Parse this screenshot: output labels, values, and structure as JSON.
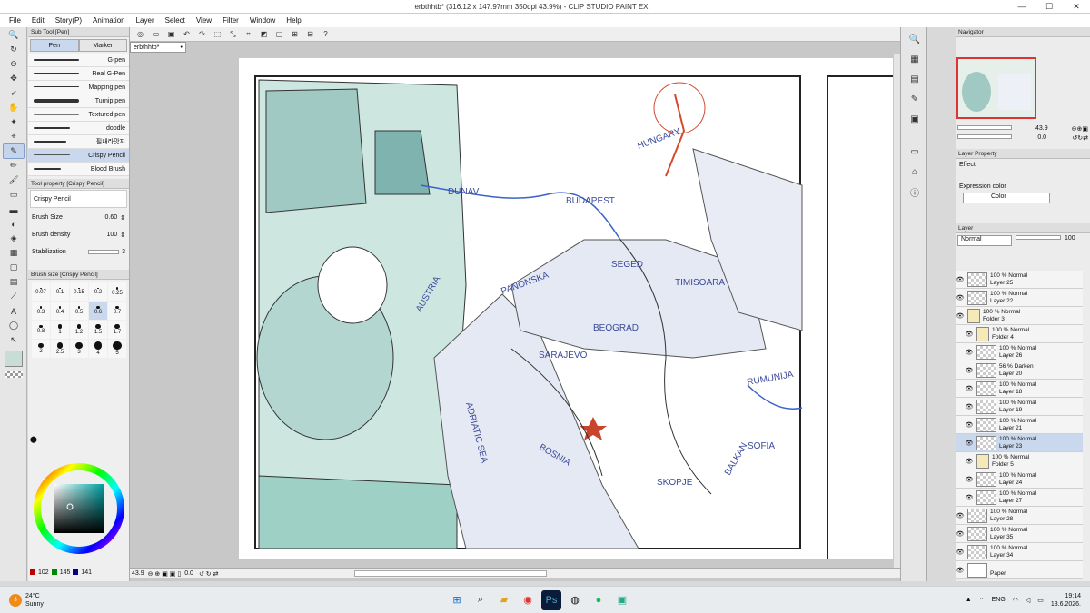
{
  "window": {
    "title": "erbthhtb* (316.12 x 147.97mm 350dpi 43.9%) - CLIP STUDIO PAINT EX",
    "minimize": "—",
    "maximize": "☐",
    "close": "✕"
  },
  "menu": [
    "File",
    "Edit",
    "Story(P)",
    "Animation",
    "Layer",
    "Select",
    "View",
    "Filter",
    "Window",
    "Help"
  ],
  "subtool": {
    "header": "Sub Tool [Pen]",
    "tabs": [
      "Pen",
      "Marker"
    ],
    "brushes": [
      "G-pen",
      "Real G-Pen",
      "Mapping pen",
      "Turnip pen",
      "Textured pen",
      "doodle",
      "필내라맛지",
      "Crispy Pencil",
      "Blood Brush"
    ],
    "active_brush": "Crispy Pencil"
  },
  "tool_property": {
    "header": "Tool property [Crispy Pencil]",
    "name": "Crispy Pencil",
    "brush_size_label": "Brush Size",
    "brush_size": "0.60",
    "brush_density_label": "Brush density",
    "brush_density": "100",
    "stabilization_label": "Stabilization",
    "stabilization": "3"
  },
  "brush_size_panel": {
    "header": "Brush size [Crispy Pencil]",
    "sizes": [
      "0.07",
      "0.1",
      "0.15",
      "0.2",
      "0.25",
      "0.3",
      "0.4",
      "0.5",
      "0.6",
      "0.7",
      "0.8",
      "1",
      "1.2",
      "1.5",
      "1.7",
      "2",
      "2.5",
      "3",
      "4",
      "5"
    ],
    "active": "0.6"
  },
  "color": {
    "r": "102",
    "g": "145",
    "b": "141",
    "main": "#66918d"
  },
  "canvas": {
    "doc_tab": "erbthhtb*",
    "zoom": "43.9",
    "rotation": "0.0",
    "map_labels": [
      "DUNAV",
      "PANONSKA",
      "AUSTRIA",
      "ADRIATIC SEA",
      "SARAJEVO",
      "SOFIA",
      "HUNGARY",
      "RUMUNIJA",
      "TIMISOARA",
      "BALKAN",
      "BEOGRAD",
      "SEGED",
      "BUDAPEST",
      "SKOPJE",
      "BOSNIA"
    ]
  },
  "navigator": {
    "header": "Navigator",
    "zoom": "43.9",
    "angle": "0.0"
  },
  "layer_property": {
    "header": "Layer Property",
    "effect": "Effect",
    "expression_color": "Expression color",
    "color_mode": "Color"
  },
  "layer_panel": {
    "header": "Layer",
    "blend": "Normal",
    "opacity": "100",
    "layers": [
      {
        "mode": "100 % Normal",
        "name": "Layer 25",
        "indent": 0,
        "type": "layer"
      },
      {
        "mode": "100 % Normal",
        "name": "Layer 22",
        "indent": 0,
        "type": "layer"
      },
      {
        "mode": "100 % Normal",
        "name": "Folder 3",
        "indent": 0,
        "type": "folder"
      },
      {
        "mode": "100 % Normal",
        "name": "Folder 4",
        "indent": 1,
        "type": "folder"
      },
      {
        "mode": "100 % Normal",
        "name": "Layer 26",
        "indent": 1,
        "type": "layer"
      },
      {
        "mode": "56 % Darken",
        "name": "Layer 20",
        "indent": 1,
        "type": "layer"
      },
      {
        "mode": "100 % Normal",
        "name": "Layer 18",
        "indent": 1,
        "type": "layer"
      },
      {
        "mode": "100 % Normal",
        "name": "Layer 19",
        "indent": 1,
        "type": "layer"
      },
      {
        "mode": "100 % Normal",
        "name": "Layer 21",
        "indent": 1,
        "type": "layer"
      },
      {
        "mode": "100 % Normal",
        "name": "Layer 23",
        "indent": 1,
        "type": "layer",
        "active": true
      },
      {
        "mode": "100 % Normal",
        "name": "Folder 5",
        "indent": 1,
        "type": "folder"
      },
      {
        "mode": "100 % Normal",
        "name": "Layer 24",
        "indent": 1,
        "type": "layer"
      },
      {
        "mode": "100 % Normal",
        "name": "Layer 27",
        "indent": 1,
        "type": "layer"
      },
      {
        "mode": "100 % Normal",
        "name": "Layer 28",
        "indent": 0,
        "type": "layer"
      },
      {
        "mode": "100 % Normal",
        "name": "Layer 35",
        "indent": 0,
        "type": "layer"
      },
      {
        "mode": "100 % Normal",
        "name": "Layer 34",
        "indent": 0,
        "type": "layer"
      },
      {
        "mode": "",
        "name": "Paper",
        "indent": 0,
        "type": "paper"
      }
    ]
  },
  "taskbar": {
    "weather_temp": "24°C",
    "weather_desc": "Sunny",
    "weather_badge": "3",
    "lang": "ENG",
    "time": "19:14",
    "date": "13.6.2026."
  }
}
